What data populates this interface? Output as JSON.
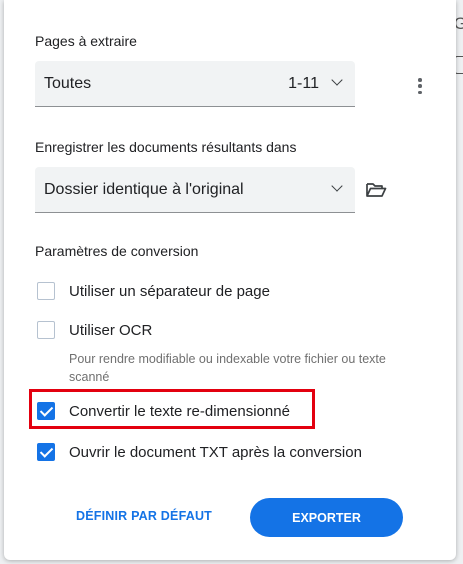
{
  "background": {
    "partial_text": "G"
  },
  "pages": {
    "label": "Pages à extraire",
    "selected": "Toutes",
    "range": "1-11"
  },
  "save": {
    "label": "Enregistrer les documents résultants dans",
    "selected": "Dossier identique à l'original"
  },
  "conversion": {
    "label": "Paramètres de conversion",
    "options": [
      {
        "label": "Utiliser un séparateur de page",
        "checked": false
      },
      {
        "label": "Utiliser OCR",
        "checked": false
      },
      {
        "label": "Convertir le texte re-dimensionné",
        "checked": true
      },
      {
        "label": "Ouvrir le document TXT après la conversion",
        "checked": true
      }
    ],
    "ocr_hint": "Pour rendre modifiable ou indexable votre fichier ou texte scanné"
  },
  "actions": {
    "default_label": "DÉFINIR PAR DÉFAUT",
    "export_label": "EXPORTER"
  },
  "colors": {
    "accent": "#1473e6",
    "highlight": "#e3000f"
  }
}
